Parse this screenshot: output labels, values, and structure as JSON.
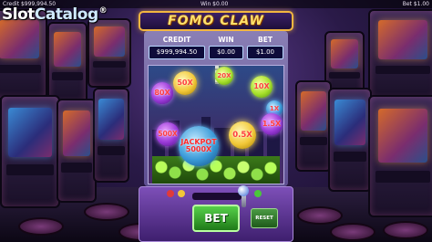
{
  "status_bar": {
    "credit": "Credit $999,994.50",
    "win": "Win $0.00",
    "bet": "Bet $1.00"
  },
  "watermark": {
    "prefix": "Slot",
    "suffix": "Catalog",
    "trademark": "®"
  },
  "machine": {
    "title": "FOMO CLAW",
    "meters": [
      {
        "label": "CREDIT",
        "value": "$999,994.50"
      },
      {
        "label": "WIN",
        "value": "$0.00"
      },
      {
        "label": "BET",
        "value": "$1.00"
      }
    ]
  },
  "orbs": {
    "o50x": "50X",
    "o20x": "20X",
    "o10x": "10X",
    "o80x": "80X",
    "o1x": "1X",
    "o500x": "500X",
    "jackpot_line1": "JACKPOT",
    "jackpot_line2": "5000X",
    "o05x": "0.5X",
    "o15x": "1.5X"
  },
  "buttons": {
    "bet": "BET",
    "reset": "RESET"
  }
}
